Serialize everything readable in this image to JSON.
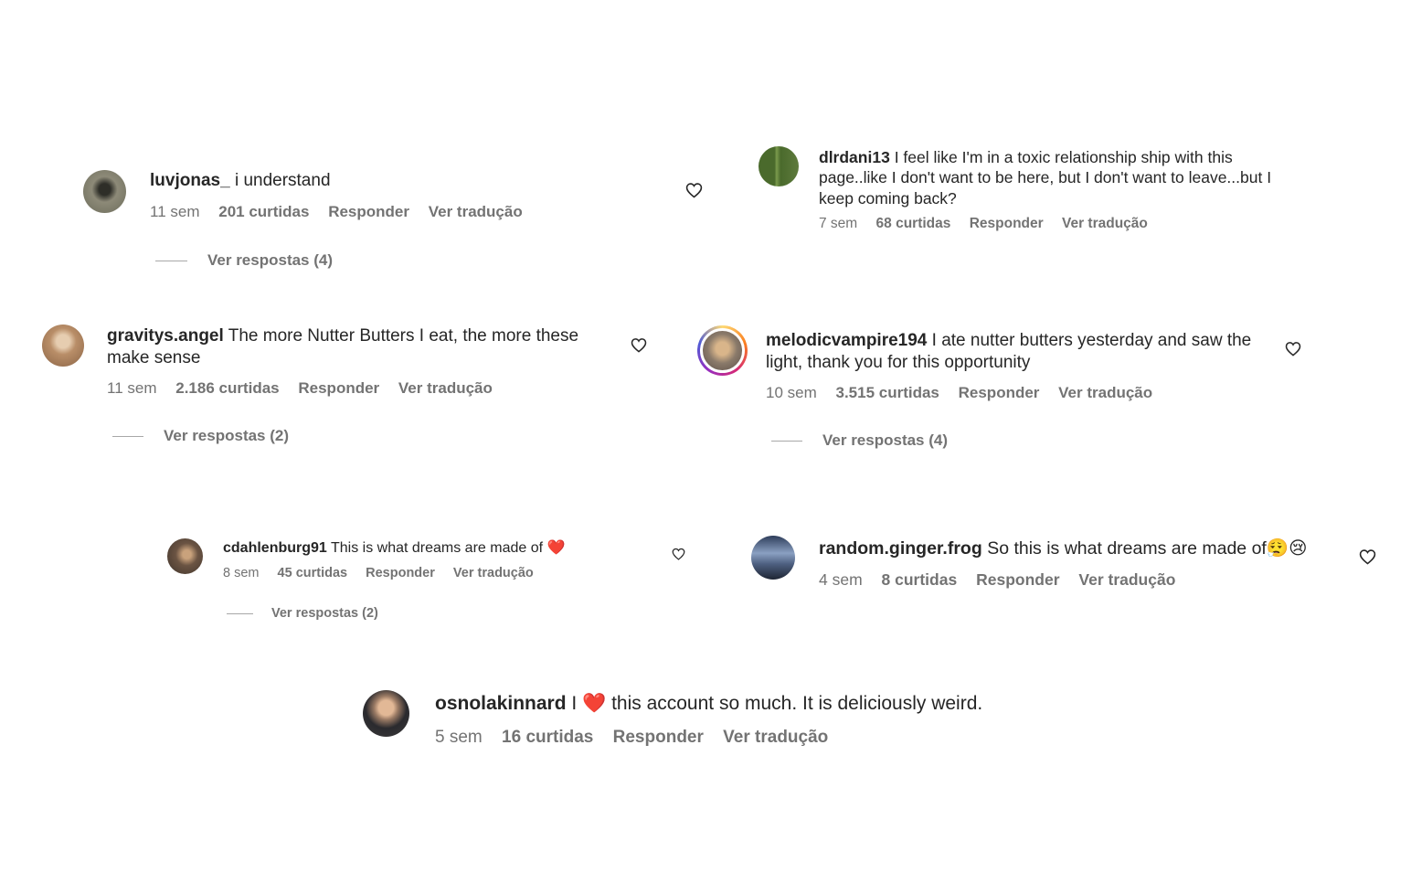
{
  "comments": [
    {
      "username": "luvjonas_",
      "text": "i understand",
      "time": "11 sem",
      "likes": "201 curtidas",
      "reply_label": "Responder",
      "translate_label": "Ver tradução",
      "view_replies": "Ver respostas (4)",
      "avatar_color": "#6b6b5a"
    },
    {
      "username": "dlrdani13",
      "text": "I feel like I'm in a toxic relationship ship with this page..like I don't want to be here, but I don't want to leave...but I keep coming back?",
      "time": "7 sem",
      "likes": "68 curtidas",
      "reply_label": "Responder",
      "translate_label": "Ver tradução",
      "avatar_color": "#5e7a3c"
    },
    {
      "username": "gravitys.angel",
      "text": "The more Nutter Butters I eat, the more these make sense",
      "time": "11 sem",
      "likes": "2.186 curtidas",
      "reply_label": "Responder",
      "translate_label": "Ver tradução",
      "view_replies": "Ver respostas (2)",
      "avatar_color": "#9c7456"
    },
    {
      "username": "melodicvampire194",
      "text": "I ate nutter butters yesterday and saw the light, thank you for this opportunity",
      "time": "10 sem",
      "likes": "3.515 curtidas",
      "reply_label": "Responder",
      "translate_label": "Ver tradução",
      "view_replies": "Ver respostas (4)",
      "avatar_color": "#8a7a6a"
    },
    {
      "username": "cdahlenburg91",
      "text": "This is what dreams are made of",
      "emoji": "❤️",
      "time": "8 sem",
      "likes": "45 curtidas",
      "reply_label": "Responder",
      "translate_label": "Ver tradução",
      "view_replies": "Ver respostas (2)",
      "avatar_color": "#5a4a3e"
    },
    {
      "username": "random.ginger.frog",
      "text": "So this is what dreams are made of",
      "emoji": "😮‍💨😢",
      "time": "4 sem",
      "likes": "8 curtidas",
      "reply_label": "Responder",
      "translate_label": "Ver tradução",
      "avatar_color": "#4d5f80"
    },
    {
      "username": "osnolakinnard",
      "text_before": "I",
      "emoji": "❤️",
      "text": "this account so much. It is deliciously weird.",
      "time": "5 sem",
      "likes": "16 curtidas",
      "reply_label": "Responder",
      "translate_label": "Ver tradução",
      "avatar_color": "#3c3a3a"
    }
  ]
}
